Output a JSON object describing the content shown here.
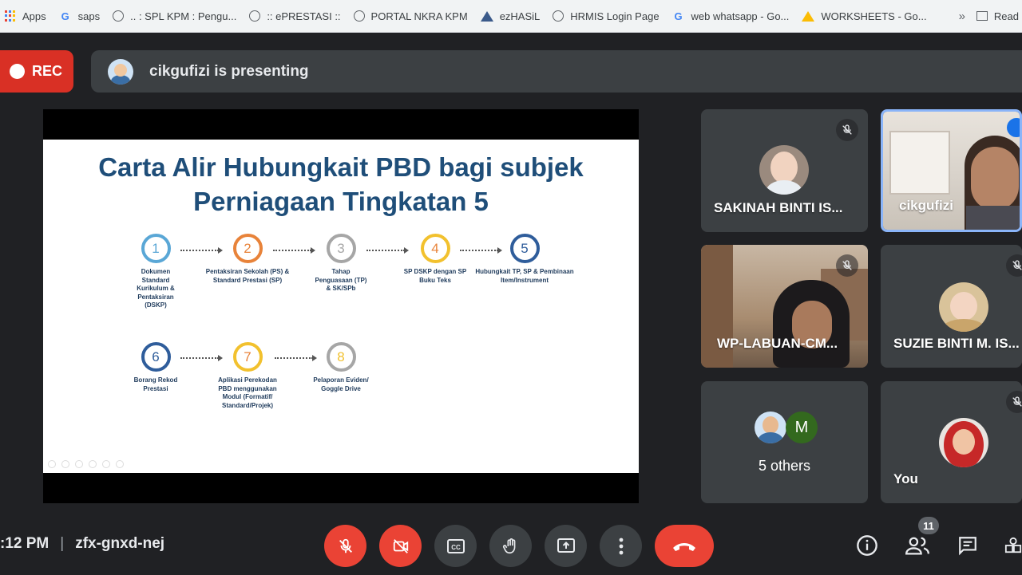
{
  "bookmarks": {
    "items": [
      {
        "label": "Apps",
        "icon": "apps-grid-icon"
      },
      {
        "label": "saps",
        "icon": "google-icon"
      },
      {
        "label": ".. : SPL KPM : Pengu...",
        "icon": "globe-icon"
      },
      {
        "label": ":: ePRESTASI ::",
        "icon": "globe-icon"
      },
      {
        "label": "PORTAL NKRA KPM",
        "icon": "globe-icon"
      },
      {
        "label": "ezHASiL",
        "icon": "ezhasil-icon"
      },
      {
        "label": "HRMIS Login Page",
        "icon": "globe-icon"
      },
      {
        "label": "web whatsapp - Go...",
        "icon": "google-icon"
      },
      {
        "label": "WORKSHEETS - Go...",
        "icon": "drive-icon"
      }
    ],
    "more": "»",
    "reading_list": "Read"
  },
  "meeting": {
    "rec_label": "REC",
    "presenting_text": "cikgufizi is presenting",
    "time": ":12 PM",
    "time_prefix": "•",
    "code": "zfx-gnxd-nej",
    "participant_count": "11"
  },
  "slide": {
    "title_line1": "Carta Alir Hubungkait PBD bagi subjek",
    "title_line2": "Perniagaan Tingkatan 5",
    "steps": [
      {
        "num": "1",
        "label": "Dokumen Standard Kurikulum & Pentaksiran (DSKP)",
        "color": "#5aa7d6"
      },
      {
        "num": "2",
        "label": "Pentaksiran Sekolah (PS) & Standard Prestasi (SP)",
        "color": "#e8833a"
      },
      {
        "num": "3",
        "label": "Tahap Penguasaan (TP) & SK/SPb",
        "color": "#a6a6a6"
      },
      {
        "num": "4",
        "label": "SP DSKP dengan SP Buku Teks",
        "color": "#f2c12e"
      },
      {
        "num": "5",
        "label": "Hubungkait TP, SP & Pembinaan Item/Instrument",
        "color": "#2f5d9b"
      },
      {
        "num": "6",
        "label": "Borang Rekod Prestasi",
        "color": "#2f5d9b"
      },
      {
        "num": "7",
        "label": "Aplikasi Perekodan PBD menggunakan Modul (Formatif/ Standard/Projek)",
        "color": "#f2c12e"
      },
      {
        "num": "8",
        "label": "Pelaporan Eviden/ Goggle Drive",
        "color": "#a6a6a6"
      }
    ]
  },
  "participants": [
    {
      "name": "SAKINAH BINTI IS...",
      "muted": true
    },
    {
      "name": "cikgufizi",
      "muted": false
    },
    {
      "name": "WP-LABUAN-CM...",
      "muted": true
    },
    {
      "name": "SUZIE BINTI M. IS...",
      "muted": true
    },
    {
      "name": "5 others",
      "initial": "M"
    },
    {
      "name": "You",
      "muted": true
    }
  ],
  "colors": {
    "background": "#202124",
    "tile": "#3c4043",
    "danger": "#ea4335",
    "rec": "#d93025",
    "slide_title": "#1f4e79"
  }
}
